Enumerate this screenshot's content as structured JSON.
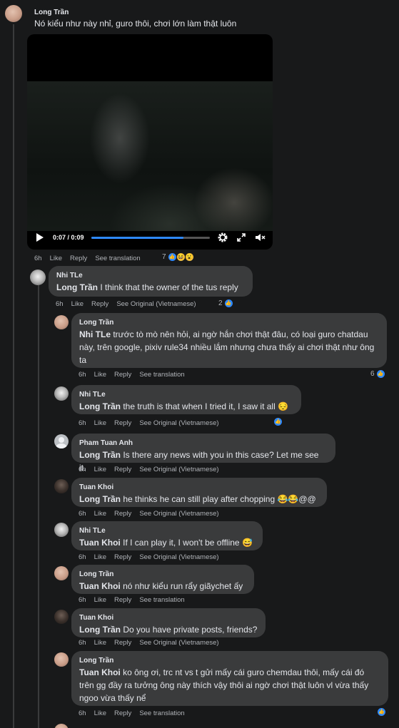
{
  "comments": [
    {
      "author": "Long Trần",
      "text": "Nó kiểu như này nhỉ, guro thôi, chơi lớn làm thật luôn",
      "time": "6h",
      "like": "Like",
      "reply": "Reply",
      "translate": "See translation",
      "reaction_count": "7",
      "video": {
        "time": "0:07 / 0:09",
        "progress": 0.78
      }
    },
    {
      "author": "Nhi TLe",
      "mention": "Long Trần",
      "text": " I think that the owner of the tus reply",
      "time": "6h",
      "like": "Like",
      "reply": "Reply",
      "translate": "See Original (Vietnamese)",
      "reaction_count": "2"
    },
    {
      "author": "Long Trần",
      "mention": "Nhi TLe",
      "text": " trước tò mò nên hỏi, ai ngờ hắn chơi thật đâu, có loại guro chatdau này, trên google, pixiv rule34 nhiều lắm nhưng chưa thấy ai chơi thật như ông ta",
      "time": "6h",
      "like": "Like",
      "reply": "Reply",
      "translate": "See translation",
      "reaction_count": "6"
    },
    {
      "author": "Nhi TLe",
      "mention": "Long Trần",
      "text": " the truth is that when I tried it, I saw it all 😔",
      "time": "6h",
      "like": "Like",
      "reply": "Reply",
      "translate": "See Original (Vietnamese)"
    },
    {
      "author": "Pham Tuan Anh",
      "mention": "Long Trần",
      "text": " Is there any news with you in this case? Let me see it.",
      "time": "6h",
      "like": "Like",
      "reply": "Reply",
      "translate": "See Original (Vietnamese)"
    },
    {
      "author": "Tuan Khoi",
      "mention": "Long Trần",
      "text": " he thinks he can still play after chopping 😂😂@@",
      "time": "6h",
      "like": "Like",
      "reply": "Reply",
      "translate": "See Original (Vietnamese)"
    },
    {
      "author": "Nhi TLe",
      "mention": "Tuan Khoi",
      "text": " If I can play it, I won't be offline 😅",
      "time": "6h",
      "like": "Like",
      "reply": "Reply",
      "translate": "See Original (Vietnamese)"
    },
    {
      "author": "Long Trần",
      "mention": "Tuan Khoi",
      "text": " nó như kiểu run rẩy giãychet ấy",
      "time": "6h",
      "like": "Like",
      "reply": "Reply",
      "translate": "See translation"
    },
    {
      "author": "Tuan Khoi",
      "mention": "Long Trần",
      "text": " Do you have private posts, friends?",
      "time": "6h",
      "like": "Like",
      "reply": "Reply",
      "translate": "See Original (Vietnamese)"
    },
    {
      "author": "Long Trần",
      "mention": "Tuan Khoi",
      "text": " ko ông ơi, trc nt vs t gửi mấy cái guro chemdau thôi, mấy cái đó trên gg đầy ra tưởng ông này thích vậy thôi ai ngờ chơi thật luôn vl vừa thấy ngoo vừa thấy nể",
      "time": "6h",
      "like": "Like",
      "reply": "Reply",
      "translate": "See translation"
    }
  ],
  "colors": {
    "background": "#18191a",
    "bubble": "#3a3b3c",
    "accent": "#2e89ff",
    "muted": "#b0b3b8"
  }
}
